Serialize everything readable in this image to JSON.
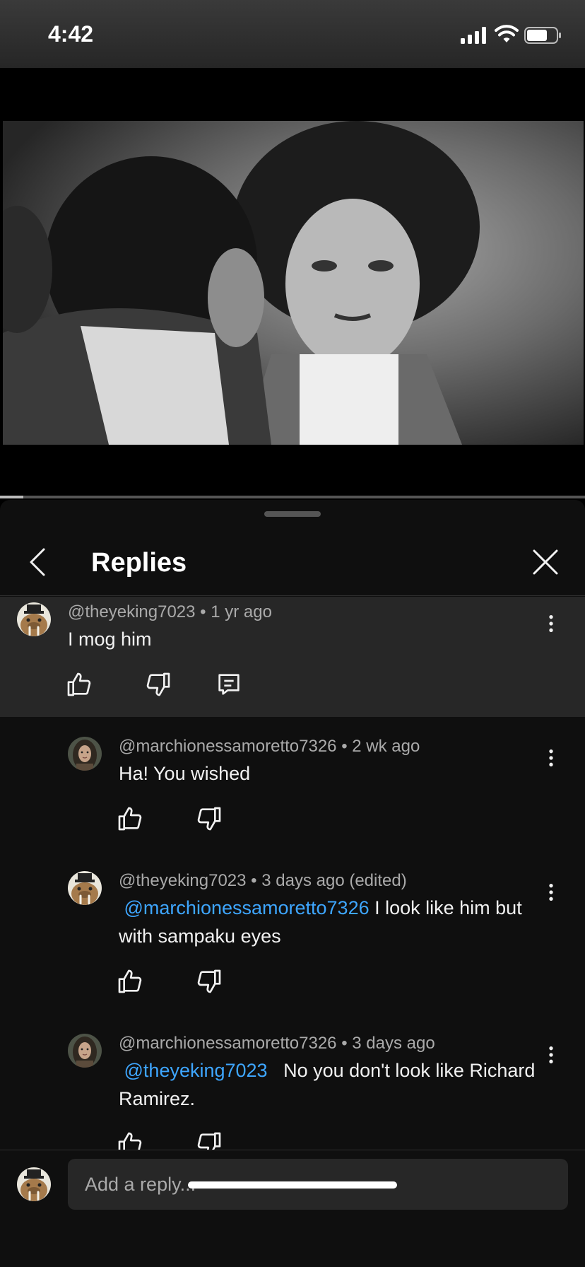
{
  "status_bar": {
    "time": "4:42",
    "battery_level": 0.7
  },
  "video": {
    "progress": 0.04
  },
  "panel": {
    "title": "Replies"
  },
  "parent_comment": {
    "author": "@theyeking7023",
    "age": "1 yr ago",
    "text": "I mog him"
  },
  "replies": [
    {
      "author": "@marchionessamoretto7326",
      "age": "2 wk ago",
      "mention": "",
      "text": "Ha! You wished"
    },
    {
      "author": "@theyeking7023",
      "age": "3 days ago (edited)",
      "mention": "@marchionessamoretto7326",
      "text": " I look like him but with sampaku eyes"
    },
    {
      "author": "@marchionessamoretto7326",
      "age": "3 days ago",
      "mention": "@theyeking7023",
      "text": "   No you don't look like Richard Ramirez."
    }
  ],
  "composer": {
    "placeholder": "Add a reply..."
  },
  "colors": {
    "mention": "#3ea6ff",
    "panel_bg": "#0f0f0f",
    "parent_bg": "#272727"
  }
}
